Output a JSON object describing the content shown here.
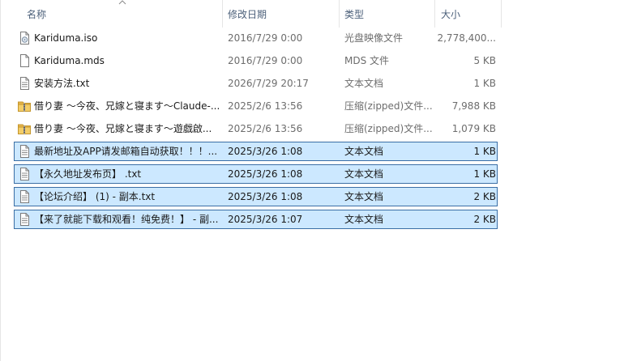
{
  "header": {
    "name": "名称",
    "date": "修改日期",
    "type": "类型",
    "size": "大小"
  },
  "colors": {
    "selection_bg": "#cce8ff",
    "selection_border": "#3a6ea5",
    "header_text": "#4c607a",
    "zip_folder": "#e8b64a"
  },
  "files": [
    {
      "name": "Kariduma.iso",
      "date": "2016/7/29 0:00",
      "type": "光盘映像文件",
      "size": "2,778,400...",
      "icon": "disc-file-icon",
      "selected": false
    },
    {
      "name": "Kariduma.mds",
      "date": "2016/7/29 0:00",
      "type": "MDS 文件",
      "size": "5 KB",
      "icon": "blank-file-icon",
      "selected": false
    },
    {
      "name": "安装方法.txt",
      "date": "2026/7/29 20:17",
      "type": "文本文档",
      "size": "1 KB",
      "icon": "text-file-icon",
      "selected": false
    },
    {
      "name": "借り妻 ～今夜、兄嫁と寝ます～Claude-...",
      "date": "2025/2/6 13:56",
      "type": "压缩(zipped)文件...",
      "size": "7,988 KB",
      "icon": "zip-folder-icon",
      "selected": false
    },
    {
      "name": "借り妻 ～今夜、兄嫁と寝ます～遊戯啟...",
      "date": "2025/2/6 13:56",
      "type": "压缩(zipped)文件...",
      "size": "1,079 KB",
      "icon": "zip-folder-icon",
      "selected": false
    },
    {
      "name": "最新地址及APP请发邮箱自动获取！！！...",
      "date": "2025/3/26 1:08",
      "type": "文本文档",
      "size": "1 KB",
      "icon": "text-file-icon",
      "selected": true
    },
    {
      "name": "【永久地址发布页】 .txt",
      "date": "2025/3/26 1:08",
      "type": "文本文档",
      "size": "1 KB",
      "icon": "text-file-icon",
      "selected": true
    },
    {
      "name": "【论坛介绍】 (1) - 副本.txt",
      "date": "2025/3/26 1:08",
      "type": "文本文档",
      "size": "2 KB",
      "icon": "text-file-icon",
      "selected": true
    },
    {
      "name": "【来了就能下载和观看！纯免费！】 - 副...",
      "date": "2025/3/26 1:07",
      "type": "文本文档",
      "size": "2 KB",
      "icon": "text-file-icon",
      "selected": true
    }
  ]
}
